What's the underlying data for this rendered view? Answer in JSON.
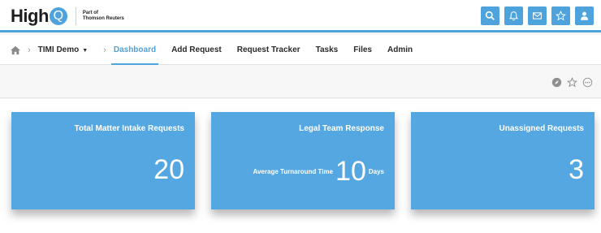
{
  "header": {
    "logo_text": "High",
    "logo_q": "Q",
    "logo_sub_line1": "Part of",
    "logo_sub_line2": "Thomson Reuters",
    "icons": [
      "search-icon",
      "bell-icon",
      "mail-icon",
      "star-icon",
      "user-icon"
    ],
    "accent": "#4ea3dd"
  },
  "nav": {
    "home_icon": "home-icon",
    "site_label": "TIMI Demo",
    "items": [
      {
        "label": "Dashboard",
        "active": true
      },
      {
        "label": "Add Request",
        "active": false
      },
      {
        "label": "Request Tracker",
        "active": false
      },
      {
        "label": "Tasks",
        "active": false
      },
      {
        "label": "Files",
        "active": false
      },
      {
        "label": "Admin",
        "active": false
      }
    ]
  },
  "toolbar": {
    "icons": [
      "compass-icon",
      "star-outline-icon",
      "more-icon"
    ]
  },
  "cards": [
    {
      "title": "Total Matter Intake Requests",
      "value": "20"
    },
    {
      "title": "Legal Team Response",
      "sub_label": "Average Turnaround Time",
      "value": "10",
      "unit": "Days"
    },
    {
      "title": "Unassigned Requests",
      "value": "3"
    }
  ],
  "colors": {
    "card_bg": "#55a7e2",
    "text_dark": "#2a2a2a"
  }
}
